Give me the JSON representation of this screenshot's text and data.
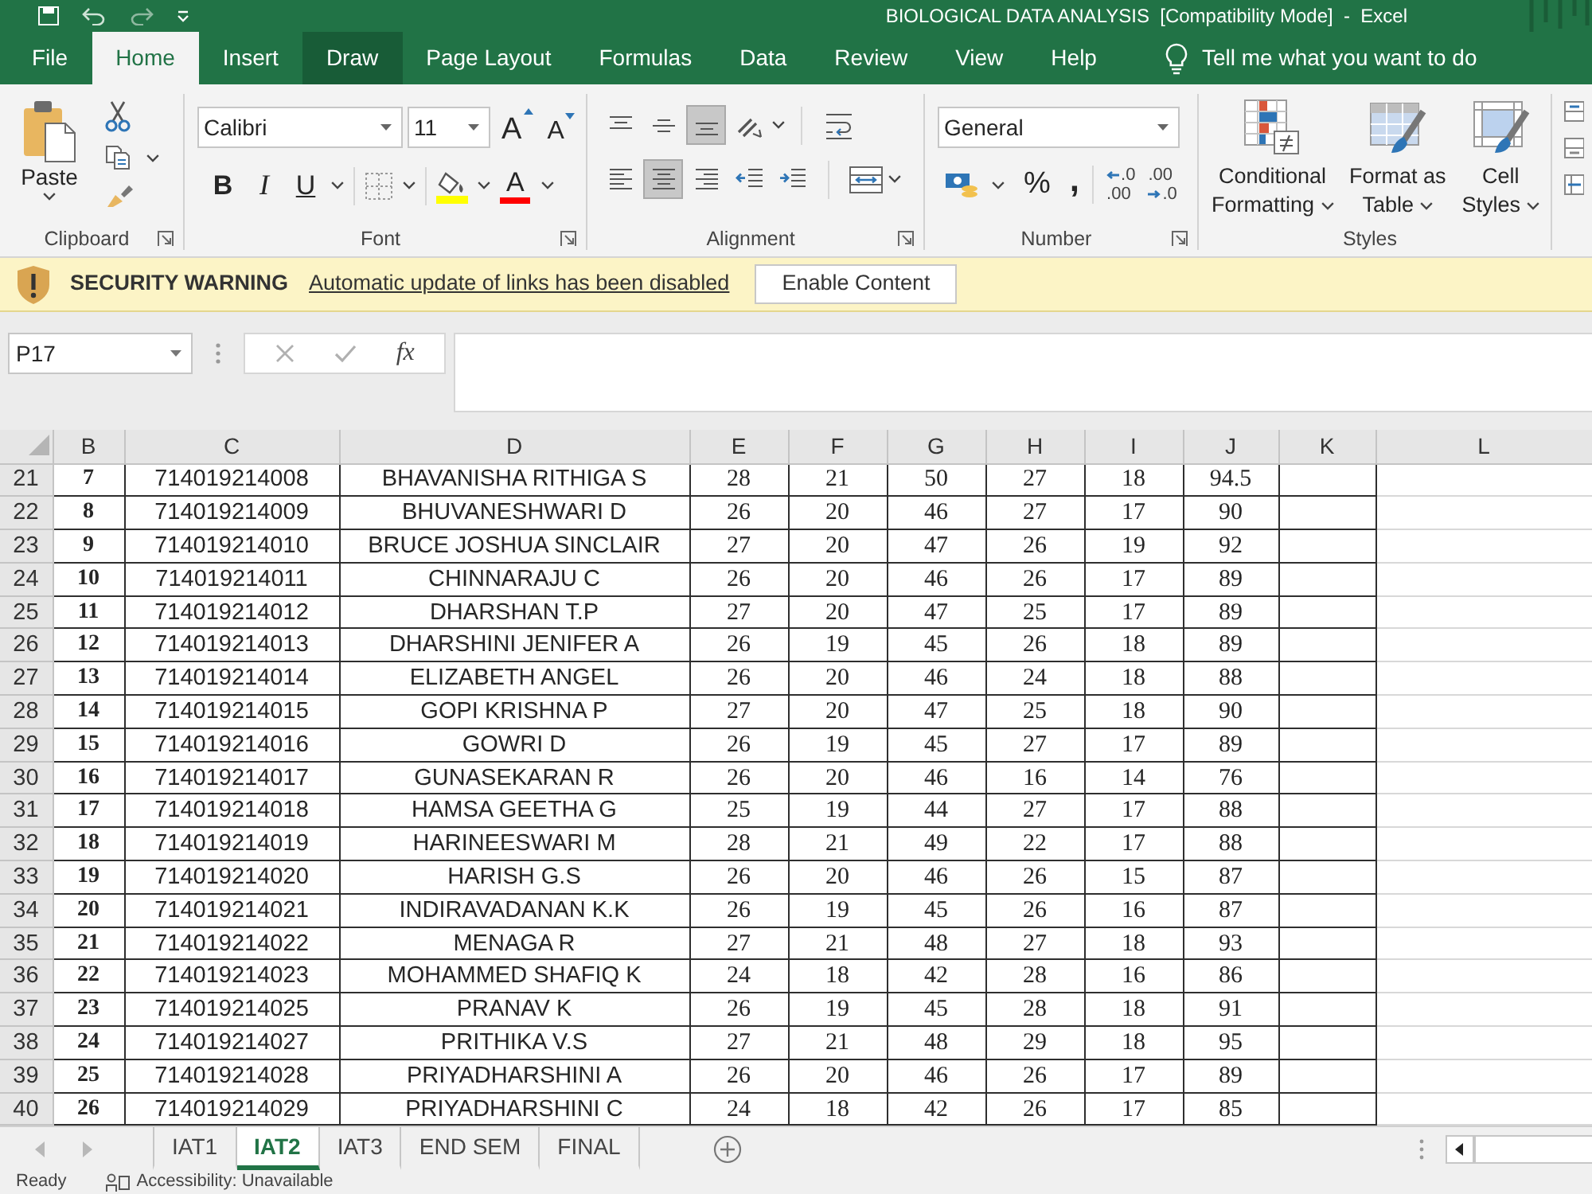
{
  "window": {
    "title": "BIOLOGICAL DATA ANALYSIS  [Compatibility Mode]  -  Excel"
  },
  "ribbon_tabs": [
    {
      "label": "File",
      "selected": false,
      "highlighted": false
    },
    {
      "label": "Home",
      "selected": true,
      "highlighted": false
    },
    {
      "label": "Insert",
      "selected": false,
      "highlighted": false
    },
    {
      "label": "Draw",
      "selected": false,
      "highlighted": true
    },
    {
      "label": "Page Layout",
      "selected": false,
      "highlighted": false
    },
    {
      "label": "Formulas",
      "selected": false,
      "highlighted": false
    },
    {
      "label": "Data",
      "selected": false,
      "highlighted": false
    },
    {
      "label": "Review",
      "selected": false,
      "highlighted": false
    },
    {
      "label": "View",
      "selected": false,
      "highlighted": false
    },
    {
      "label": "Help",
      "selected": false,
      "highlighted": false
    }
  ],
  "tell_me": {
    "placeholder": "Tell me what you want to do"
  },
  "ribbon": {
    "clipboard": {
      "label": "Clipboard",
      "paste": "Paste"
    },
    "font": {
      "label": "Font",
      "font_name": "Calibri",
      "font_size": "11",
      "grow_font": "A",
      "shrink_font": "A",
      "bold": "B",
      "italic": "I",
      "underline": "U",
      "font_color": "A"
    },
    "alignment": {
      "label": "Alignment",
      "rows": [
        [
          {
            "kind": "align-top",
            "pressed": false
          },
          {
            "kind": "align-middle",
            "pressed": false
          },
          {
            "kind": "align-bottom",
            "pressed": true
          },
          {
            "kind": "orientation",
            "pressed": false
          },
          {
            "kind": "wrap-text",
            "pressed": false
          }
        ],
        [
          {
            "kind": "align-left",
            "pressed": false
          },
          {
            "kind": "align-center",
            "pressed": true
          },
          {
            "kind": "align-right",
            "pressed": false
          },
          {
            "kind": "indent-decrease",
            "pressed": false
          },
          {
            "kind": "indent-increase",
            "pressed": false
          },
          {
            "kind": "merge",
            "pressed": false
          }
        ]
      ]
    },
    "number": {
      "label": "Number",
      "format": "General",
      "percent": "%",
      "comma": ",",
      "increase_decimal": [
        ".0",
        ".00"
      ],
      "decrease_decimal": [
        ".00",
        ".0"
      ]
    },
    "styles": {
      "label": "Styles",
      "buttons": [
        {
          "kind": "conditional-formatting",
          "lines": [
            "Conditional",
            "Formatting"
          ]
        },
        {
          "kind": "format-as-table",
          "lines": [
            "Format as",
            "Table"
          ]
        },
        {
          "kind": "cell-styles",
          "lines": [
            "Cell",
            "Styles"
          ]
        }
      ]
    }
  },
  "security_bar": {
    "title": "SECURITY WARNING",
    "message": "Automatic update of links has been disabled",
    "button": "Enable Content"
  },
  "formula_bar": {
    "name_box": "P17",
    "function_button": "fx"
  },
  "sheet": {
    "columns": [
      "B",
      "C",
      "D",
      "E",
      "F",
      "G",
      "H",
      "I",
      "J",
      "K",
      "L"
    ],
    "rows": [
      {
        "number": "21",
        "cells": [
          "7",
          "714019214008",
          "BHAVANISHA RITHIGA S",
          "28",
          "21",
          "50",
          "27",
          "18",
          "94.5"
        ]
      },
      {
        "number": "22",
        "cells": [
          "8",
          "714019214009",
          "BHUVANESHWARI D",
          "26",
          "20",
          "46",
          "27",
          "17",
          "90"
        ]
      },
      {
        "number": "23",
        "cells": [
          "9",
          "714019214010",
          "BRUCE JOSHUA SINCLAIR",
          "27",
          "20",
          "47",
          "26",
          "19",
          "92"
        ]
      },
      {
        "number": "24",
        "cells": [
          "10",
          "714019214011",
          "CHINNARAJU C",
          "26",
          "20",
          "46",
          "26",
          "17",
          "89"
        ]
      },
      {
        "number": "25",
        "cells": [
          "11",
          "714019214012",
          "DHARSHAN T.P",
          "27",
          "20",
          "47",
          "25",
          "17",
          "89"
        ]
      },
      {
        "number": "26",
        "cells": [
          "12",
          "714019214013",
          "DHARSHINI JENIFER A",
          "26",
          "19",
          "45",
          "26",
          "18",
          "89"
        ]
      },
      {
        "number": "27",
        "cells": [
          "13",
          "714019214014",
          "ELIZABETH ANGEL",
          "26",
          "20",
          "46",
          "24",
          "18",
          "88"
        ]
      },
      {
        "number": "28",
        "cells": [
          "14",
          "714019214015",
          "GOPI KRISHNA P",
          "27",
          "20",
          "47",
          "25",
          "18",
          "90"
        ]
      },
      {
        "number": "29",
        "cells": [
          "15",
          "714019214016",
          "GOWRI D",
          "26",
          "19",
          "45",
          "27",
          "17",
          "89"
        ]
      },
      {
        "number": "30",
        "cells": [
          "16",
          "714019214017",
          "GUNASEKARAN R",
          "26",
          "20",
          "46",
          "16",
          "14",
          "76"
        ]
      },
      {
        "number": "31",
        "cells": [
          "17",
          "714019214018",
          "HAMSA GEETHA G",
          "25",
          "19",
          "44",
          "27",
          "17",
          "88"
        ]
      },
      {
        "number": "32",
        "cells": [
          "18",
          "714019214019",
          "HARINEESWARI M",
          "28",
          "21",
          "49",
          "22",
          "17",
          "88"
        ]
      },
      {
        "number": "33",
        "cells": [
          "19",
          "714019214020",
          "HARISH G.S",
          "26",
          "20",
          "46",
          "26",
          "15",
          "87"
        ]
      },
      {
        "number": "34",
        "cells": [
          "20",
          "714019214021",
          "INDIRAVADANAN K.K",
          "26",
          "19",
          "45",
          "26",
          "16",
          "87"
        ]
      },
      {
        "number": "35",
        "cells": [
          "21",
          "714019214022",
          "MENAGA R",
          "27",
          "21",
          "48",
          "27",
          "18",
          "93"
        ]
      },
      {
        "number": "36",
        "cells": [
          "22",
          "714019214023",
          "MOHAMMED SHAFIQ K",
          "24",
          "18",
          "42",
          "28",
          "16",
          "86"
        ]
      },
      {
        "number": "37",
        "cells": [
          "23",
          "714019214025",
          "PRANAV K",
          "26",
          "19",
          "45",
          "28",
          "18",
          "91"
        ]
      },
      {
        "number": "38",
        "cells": [
          "24",
          "714019214027",
          "PRITHIKA V.S",
          "27",
          "21",
          "48",
          "29",
          "18",
          "95"
        ]
      },
      {
        "number": "39",
        "cells": [
          "25",
          "714019214028",
          "PRIYADHARSHINI A",
          "26",
          "20",
          "46",
          "26",
          "17",
          "89"
        ]
      },
      {
        "number": "40",
        "cells": [
          "26",
          "714019214029",
          "PRIYADHARSHINI C",
          "24",
          "18",
          "42",
          "26",
          "17",
          "85"
        ]
      }
    ]
  },
  "sheet_tabs": [
    {
      "label": "IAT1",
      "selected": false
    },
    {
      "label": "IAT2",
      "selected": true
    },
    {
      "label": "IAT3",
      "selected": false
    },
    {
      "label": "END SEM",
      "selected": false
    },
    {
      "label": "FINAL",
      "selected": false
    }
  ],
  "status_bar": {
    "mode": "Ready",
    "accessibility": "Accessibility: Unavailable"
  }
}
